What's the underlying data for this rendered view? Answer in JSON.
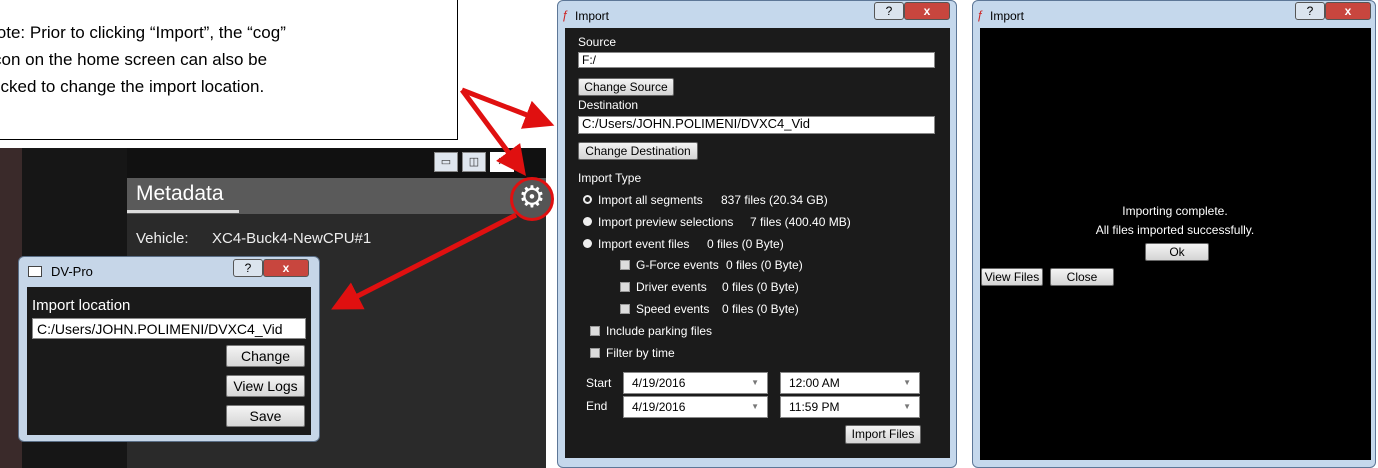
{
  "note": {
    "lines": [
      "lote: Prior to clicking “Import”, the “cog”",
      "con on the home screen can also be",
      "licked to change the import location."
    ]
  },
  "background_app": {
    "panel_title": "Metadata",
    "vehicle_label": "Vehicle:",
    "vehicle_value": "XC4-Buck4-NewCPU#1",
    "window_controls": [
      "▭",
      "◫",
      "✕"
    ]
  },
  "dvpro_dialog": {
    "title": "DV-Pro",
    "help_btn": "?",
    "close_btn": "x",
    "import_location_label": "Import location",
    "import_location_value": "C:/Users/JOHN.POLIMENI/DVXC4_Vid",
    "change_button": "Change",
    "view_logs_button": "View Logs",
    "save_button": "Save"
  },
  "import_dialog": {
    "title": "Import",
    "help_btn": "?",
    "close_btn": "x",
    "source_label": "Source",
    "source_value": "F:/",
    "change_source_button": "Change Source",
    "destination_label": "Destination",
    "destination_value": "C:/Users/JOHN.POLIMENI/DVXC4_Vid",
    "change_destination_button": "Change Destination",
    "import_type_label": "Import Type",
    "options": [
      {
        "label": "Import all segments",
        "info": "837 files (20.34 GB)",
        "selected": true
      },
      {
        "label": "Import preview selections",
        "info": "7 files (400.40 MB)",
        "selected": false
      },
      {
        "label": "Import event files",
        "info": "0 files (0 Byte)",
        "selected": false
      }
    ],
    "event_types": [
      {
        "label": "G-Force events",
        "info": "0 files (0 Byte)"
      },
      {
        "label": "Driver events",
        "info": "0 files (0 Byte)"
      },
      {
        "label": "Speed events",
        "info": "0 files (0 Byte)"
      }
    ],
    "include_parking_label": "Include parking files",
    "filter_by_time_label": "Filter by time",
    "start_label": "Start",
    "end_label": "End",
    "start_date": "4/19/2016",
    "start_time": "12:00 AM",
    "end_date": "4/19/2016",
    "end_time": "11:59 PM",
    "import_files_button": "Import Files"
  },
  "complete_dialog": {
    "title": "Import",
    "help_btn": "?",
    "close_btn": "x",
    "message_line1": "Importing complete.",
    "message_line2": "All files imported successfully.",
    "ok_button": "Ok",
    "view_files_button": "View Files",
    "close_button": "Close"
  },
  "colors": {
    "arrow": "#e01010",
    "dialog_frame": "#c5d8ec",
    "dark_body": "#1b1b1b"
  }
}
